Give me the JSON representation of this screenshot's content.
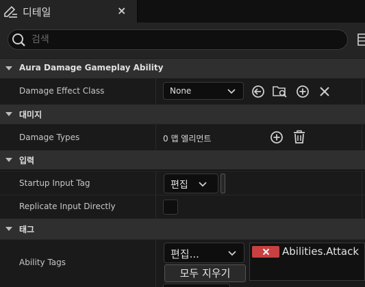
{
  "tab": {
    "title": "디테일",
    "close": "×"
  },
  "search": {
    "placeholder": "검색",
    "value": ""
  },
  "sections": {
    "ability": {
      "title": "Aura Damage Gameplay Ability"
    },
    "damage": {
      "title": "대미지"
    },
    "input": {
      "title": "입력"
    },
    "tags": {
      "title": "태그"
    }
  },
  "rows": {
    "damage_effect_class": {
      "label": "Damage Effect Class",
      "value": "None"
    },
    "damage_types": {
      "label": "Damage Types",
      "value": "0 맵 엘리먼트"
    },
    "startup_input_tag": {
      "label": "Startup Input Tag",
      "edit": "편집"
    },
    "replicate_input": {
      "label": "Replicate Input Directly",
      "checked": false
    },
    "ability_tags": {
      "label": "Ability Tags",
      "edit": "편집...",
      "clear": "모두 지우기",
      "tags": [
        "Abilities.Attack"
      ]
    }
  },
  "colors": {
    "tag_remove": "#c94040",
    "section_bg": "#2f2f2f",
    "row_bg": "#1a1a1a"
  }
}
